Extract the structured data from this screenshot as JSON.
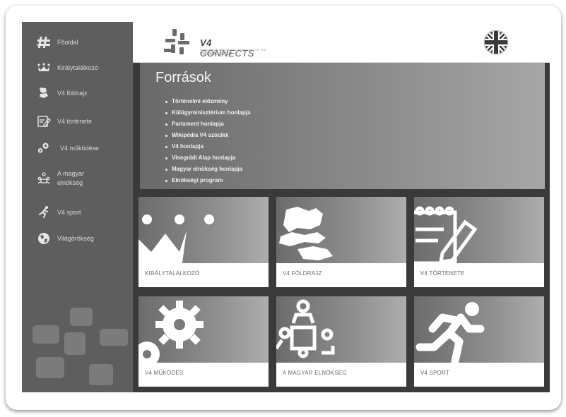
{
  "sidebar": {
    "items": [
      {
        "label": "Főoldal",
        "icon": "hash-icon"
      },
      {
        "label": "Királytalálkozó",
        "icon": "crown-icon"
      },
      {
        "label": "V4 földrajz",
        "icon": "map-icon"
      },
      {
        "label": "V4 története",
        "icon": "notepad-pencil-icon"
      },
      {
        "label": "V4 működése",
        "icon": "gears-icon"
      },
      {
        "label": "A magyar elnökség",
        "icon": "meeting-icon"
      },
      {
        "label": "V4 sport",
        "icon": "runner-icon"
      },
      {
        "label": "Világörökség",
        "icon": "globe-icon"
      }
    ]
  },
  "header": {
    "logo_bold": "V4",
    "logo_rest": " CONNECTS",
    "logo_sub1": "HUNGARIAN PRESIDENCY 2021/2022 OF THE",
    "logo_sub2": "VISEGRAD GROUP",
    "language_icon": "uk-flag-icon"
  },
  "sources": {
    "title": "Források",
    "links": [
      "Történelmi előzmény",
      "Külügyminisztérium honlapja",
      "Parlament honlapja",
      "Wikipédia V4 szócikk",
      "V4 honlapja",
      "Visegrádi Alap honlapja",
      "Magyar elnökség honlapja",
      "Elnökségi program"
    ]
  },
  "tiles": [
    {
      "label": "KIRÁLYTALÁLKOZÓ",
      "icon": "crown-icon"
    },
    {
      "label": "V4 FÖLDRAJZ",
      "icon": "map-icon"
    },
    {
      "label": "V4 TÖRTÉNETE",
      "icon": "notepad-pencil-icon"
    },
    {
      "label": "V4 MŰKÖDÉS",
      "icon": "gears-icon"
    },
    {
      "label": "A MAGYAR ELNÖKSÉG",
      "icon": "meeting-icon"
    },
    {
      "label": "V4 SPORT",
      "icon": "runner-icon"
    }
  ],
  "colors": {
    "sidebar": "#5e5e5e",
    "background": "#3a3a3a",
    "header": "#ffffff",
    "tile_caption": "#6a6a6a"
  }
}
